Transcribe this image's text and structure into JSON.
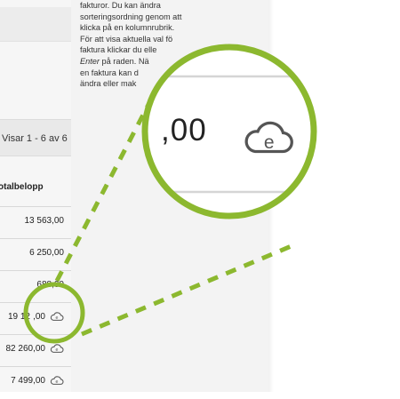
{
  "header": {
    "showing_label": "Visar 1 - 6 av 6"
  },
  "table": {
    "amount_header": "otalbelopp",
    "rows": [
      {
        "amount": "13 563,00"
      },
      {
        "amount": "6 250,00"
      },
      {
        "amount": "688,00"
      },
      {
        "amount": "19 12"
      },
      {
        "amount": "82 260,00"
      },
      {
        "amount": "7 499,00"
      }
    ],
    "row4_suffix": ",00"
  },
  "help": {
    "line1": "fakturor. Du kan ändra",
    "line2": "sorteringsordning genom att",
    "line3": "klicka på en kolumnrubrik.",
    "line4": "För att visa aktuella val fö",
    "line5": "faktura klickar du elle",
    "line6_em": "Enter",
    "line6_rest": " på raden. Nä",
    "line7": "en faktura kan d",
    "line8": "ändra eller mak"
  },
  "zoom": {
    "amount": ",00"
  },
  "icons": {
    "invoice": "e-invoice-cloud-icon"
  },
  "colors": {
    "accent": "#8cb82f",
    "icon": "#555555"
  }
}
